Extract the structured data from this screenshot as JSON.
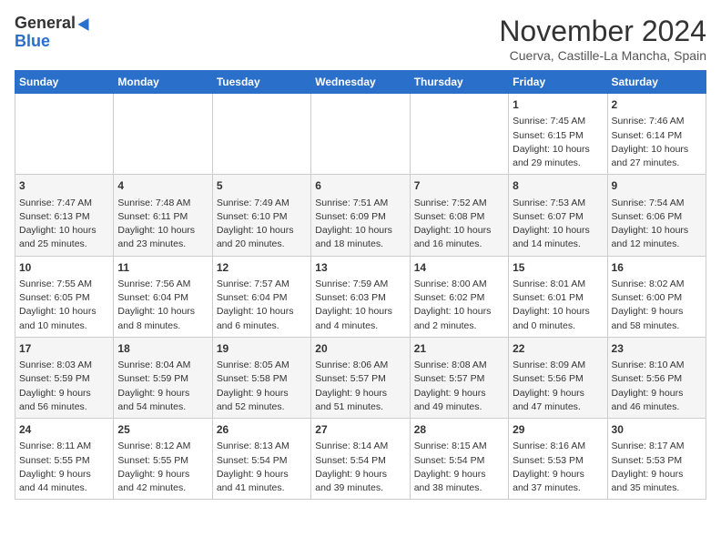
{
  "logo": {
    "line1": "General",
    "line2": "Blue"
  },
  "title": "November 2024",
  "location": "Cuerva, Castille-La Mancha, Spain",
  "weekdays": [
    "Sunday",
    "Monday",
    "Tuesday",
    "Wednesday",
    "Thursday",
    "Friday",
    "Saturday"
  ],
  "weeks": [
    [
      {
        "day": "",
        "content": ""
      },
      {
        "day": "",
        "content": ""
      },
      {
        "day": "",
        "content": ""
      },
      {
        "day": "",
        "content": ""
      },
      {
        "day": "",
        "content": ""
      },
      {
        "day": "1",
        "content": "Sunrise: 7:45 AM\nSunset: 6:15 PM\nDaylight: 10 hours\nand 29 minutes."
      },
      {
        "day": "2",
        "content": "Sunrise: 7:46 AM\nSunset: 6:14 PM\nDaylight: 10 hours\nand 27 minutes."
      }
    ],
    [
      {
        "day": "3",
        "content": "Sunrise: 7:47 AM\nSunset: 6:13 PM\nDaylight: 10 hours\nand 25 minutes."
      },
      {
        "day": "4",
        "content": "Sunrise: 7:48 AM\nSunset: 6:11 PM\nDaylight: 10 hours\nand 23 minutes."
      },
      {
        "day": "5",
        "content": "Sunrise: 7:49 AM\nSunset: 6:10 PM\nDaylight: 10 hours\nand 20 minutes."
      },
      {
        "day": "6",
        "content": "Sunrise: 7:51 AM\nSunset: 6:09 PM\nDaylight: 10 hours\nand 18 minutes."
      },
      {
        "day": "7",
        "content": "Sunrise: 7:52 AM\nSunset: 6:08 PM\nDaylight: 10 hours\nand 16 minutes."
      },
      {
        "day": "8",
        "content": "Sunrise: 7:53 AM\nSunset: 6:07 PM\nDaylight: 10 hours\nand 14 minutes."
      },
      {
        "day": "9",
        "content": "Sunrise: 7:54 AM\nSunset: 6:06 PM\nDaylight: 10 hours\nand 12 minutes."
      }
    ],
    [
      {
        "day": "10",
        "content": "Sunrise: 7:55 AM\nSunset: 6:05 PM\nDaylight: 10 hours\nand 10 minutes."
      },
      {
        "day": "11",
        "content": "Sunrise: 7:56 AM\nSunset: 6:04 PM\nDaylight: 10 hours\nand 8 minutes."
      },
      {
        "day": "12",
        "content": "Sunrise: 7:57 AM\nSunset: 6:04 PM\nDaylight: 10 hours\nand 6 minutes."
      },
      {
        "day": "13",
        "content": "Sunrise: 7:59 AM\nSunset: 6:03 PM\nDaylight: 10 hours\nand 4 minutes."
      },
      {
        "day": "14",
        "content": "Sunrise: 8:00 AM\nSunset: 6:02 PM\nDaylight: 10 hours\nand 2 minutes."
      },
      {
        "day": "15",
        "content": "Sunrise: 8:01 AM\nSunset: 6:01 PM\nDaylight: 10 hours\nand 0 minutes."
      },
      {
        "day": "16",
        "content": "Sunrise: 8:02 AM\nSunset: 6:00 PM\nDaylight: 9 hours\nand 58 minutes."
      }
    ],
    [
      {
        "day": "17",
        "content": "Sunrise: 8:03 AM\nSunset: 5:59 PM\nDaylight: 9 hours\nand 56 minutes."
      },
      {
        "day": "18",
        "content": "Sunrise: 8:04 AM\nSunset: 5:59 PM\nDaylight: 9 hours\nand 54 minutes."
      },
      {
        "day": "19",
        "content": "Sunrise: 8:05 AM\nSunset: 5:58 PM\nDaylight: 9 hours\nand 52 minutes."
      },
      {
        "day": "20",
        "content": "Sunrise: 8:06 AM\nSunset: 5:57 PM\nDaylight: 9 hours\nand 51 minutes."
      },
      {
        "day": "21",
        "content": "Sunrise: 8:08 AM\nSunset: 5:57 PM\nDaylight: 9 hours\nand 49 minutes."
      },
      {
        "day": "22",
        "content": "Sunrise: 8:09 AM\nSunset: 5:56 PM\nDaylight: 9 hours\nand 47 minutes."
      },
      {
        "day": "23",
        "content": "Sunrise: 8:10 AM\nSunset: 5:56 PM\nDaylight: 9 hours\nand 46 minutes."
      }
    ],
    [
      {
        "day": "24",
        "content": "Sunrise: 8:11 AM\nSunset: 5:55 PM\nDaylight: 9 hours\nand 44 minutes."
      },
      {
        "day": "25",
        "content": "Sunrise: 8:12 AM\nSunset: 5:55 PM\nDaylight: 9 hours\nand 42 minutes."
      },
      {
        "day": "26",
        "content": "Sunrise: 8:13 AM\nSunset: 5:54 PM\nDaylight: 9 hours\nand 41 minutes."
      },
      {
        "day": "27",
        "content": "Sunrise: 8:14 AM\nSunset: 5:54 PM\nDaylight: 9 hours\nand 39 minutes."
      },
      {
        "day": "28",
        "content": "Sunrise: 8:15 AM\nSunset: 5:54 PM\nDaylight: 9 hours\nand 38 minutes."
      },
      {
        "day": "29",
        "content": "Sunrise: 8:16 AM\nSunset: 5:53 PM\nDaylight: 9 hours\nand 37 minutes."
      },
      {
        "day": "30",
        "content": "Sunrise: 8:17 AM\nSunset: 5:53 PM\nDaylight: 9 hours\nand 35 minutes."
      }
    ]
  ]
}
